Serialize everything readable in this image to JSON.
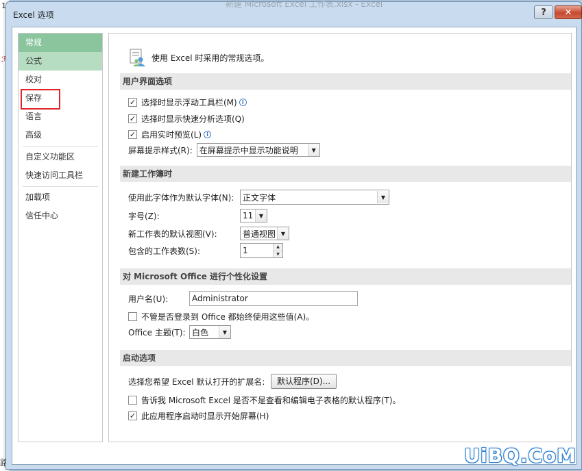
{
  "background": {
    "cell_number": "1",
    "bottom_text": "路",
    "title_text": "新建 Microsoft Excel 工作表.xlsx - Excel"
  },
  "dialog": {
    "title": "Excel 选项",
    "help_label": "?",
    "close_label": "✕"
  },
  "sidebar": {
    "items": [
      {
        "label": "常规"
      },
      {
        "label": "公式"
      },
      {
        "label": "校对"
      },
      {
        "label": "保存"
      },
      {
        "label": "语言"
      },
      {
        "label": "高级"
      },
      {
        "label": "自定义功能区"
      },
      {
        "label": "快速访问工具栏"
      },
      {
        "label": "加载项"
      },
      {
        "label": "信任中心"
      }
    ]
  },
  "main": {
    "intro": "使用 Excel 时采用的常规选项。",
    "ui_section": {
      "title": "用户界面选项",
      "options": [
        {
          "label": "选择时显示浮动工具栏(M)",
          "checked": true
        },
        {
          "label": "选择时显示快速分析选项(Q)",
          "checked": true
        },
        {
          "label": "启用实时预览(L)",
          "checked": true
        }
      ],
      "tooltip_label": "屏幕提示样式(R):",
      "tooltip_value": "在屏幕提示中显示功能说明"
    },
    "new_workbook": {
      "title": "新建工作簿时",
      "font_label": "使用此字体作为默认字体(N):",
      "font_value": "正文字体",
      "size_label": "字号(Z):",
      "size_value": "11",
      "view_label": "新工作表的默认视图(V):",
      "view_value": "普通视图",
      "sheets_label": "包含的工作表数(S):",
      "sheets_value": "1"
    },
    "personalize": {
      "title": "对 Microsoft Office 进行个性化设置",
      "username_label": "用户名(U):",
      "username_value": "Administrator",
      "always_use_label": "不管是否登录到 Office 都始终使用这些值(A)。",
      "always_use_checked": false,
      "theme_label": "Office 主题(T):",
      "theme_value": "白色"
    },
    "startup": {
      "title": "启动选项",
      "ext_label": "选择您希望 Excel 默认打开的扩展名:",
      "ext_button": "默认程序(D)...",
      "tell_me_label": "告诉我 Microsoft Excel 是否不是查看和编辑电子表格的默认程序(T)。",
      "tell_me_checked": false,
      "show_start_label": "此应用程序启动时显示开始屏幕(H)",
      "show_start_checked": true
    }
  },
  "watermark": "UiBQ.CoM",
  "colors": {
    "selected_nav": "#8ac59d",
    "highlight_box": "#e0252a",
    "close_button": "#c54a2f"
  }
}
